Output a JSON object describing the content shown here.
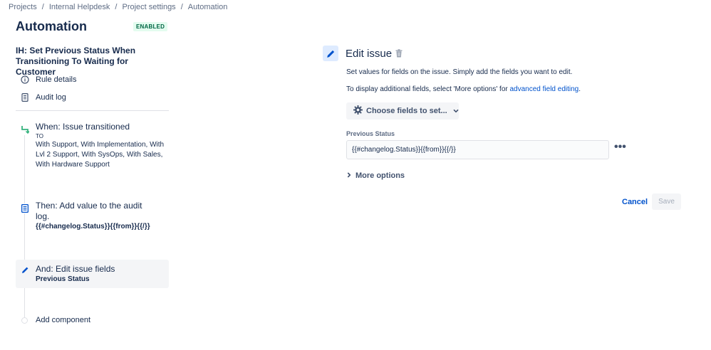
{
  "breadcrumbs": [
    "Projects",
    "Internal Helpdesk",
    "Project settings",
    "Automation"
  ],
  "breadcrumb_separator": "/",
  "page": {
    "title": "Automation",
    "status": "ENABLED"
  },
  "rule": {
    "name": "IH: Set Previous Status When Transitioning To Waiting for Customer"
  },
  "sidebar": {
    "links": [
      {
        "label": "Rule details",
        "icon": "info-icon"
      },
      {
        "label": "Audit log",
        "icon": "document-icon"
      }
    ]
  },
  "components": {
    "trigger": {
      "title": "When: Issue transitioned",
      "to_label": "TO",
      "statuses": "With Support, With Implementation, With Lvl 2 Support, With SysOps, With Sales, With Hardware Support",
      "icon": "transition-icon"
    },
    "audit": {
      "title": "Then: Add value to the audit log.",
      "value": "{{#changelog.Status}}{{from}}{{/}}",
      "icon": "audit-log-icon"
    },
    "edit": {
      "title": "And: Edit issue fields",
      "field": "Previous Status",
      "icon": "pencil-icon"
    },
    "add_label": "Add component"
  },
  "editor": {
    "title": "Edit issue",
    "description": "Set values for fields on the issue. Simply add the fields you want to edit.",
    "additional_prefix": "To display additional fields, select 'More options' for ",
    "additional_link": "advanced field editing",
    "additional_suffix": ".",
    "choose_fields_label": "Choose fields to set...",
    "field_label": "Previous Status",
    "field_value": "{{#changelog.Status}}{{from}}{{/}}",
    "more_options_label": "More options",
    "cancel_label": "Cancel",
    "save_label": "Save"
  },
  "colors": {
    "text": "#172b4d",
    "link": "#0052cc",
    "enabled_bg": "#e3fcef",
    "enabled_text": "#006644",
    "trigger_icon": "#36b37e",
    "action_icon": "#0052cc"
  }
}
